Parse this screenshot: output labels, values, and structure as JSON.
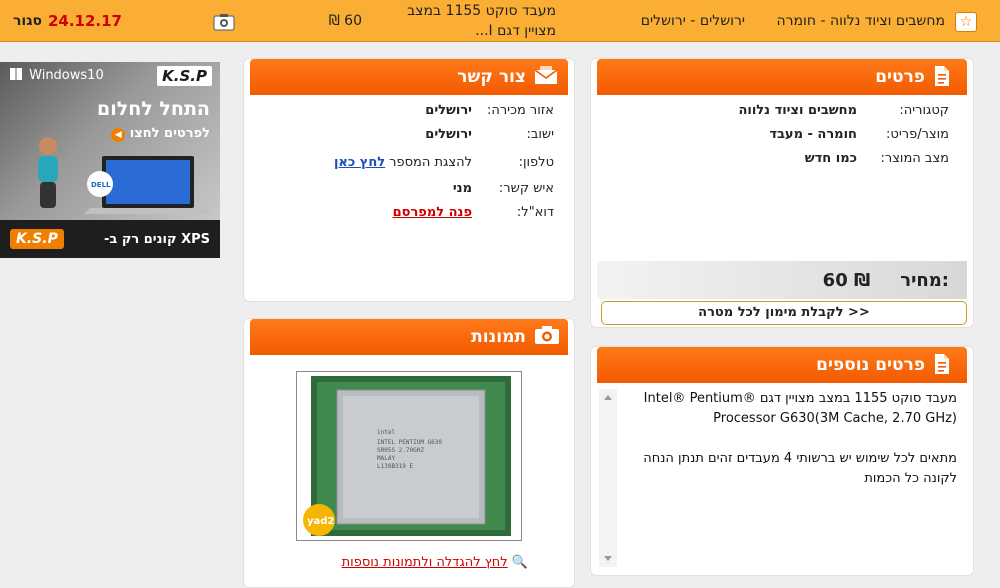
{
  "topbar": {
    "category": "מחשבים וציוד נלווה - חומרה",
    "location": "ירושלים - ירושלים",
    "title": "מעבד סוקט 1155 במצב מצויין דגם I...",
    "price": "60 ₪",
    "date": "24.12.17",
    "close": "סגור"
  },
  "details": {
    "header": "פרטים",
    "rows": [
      {
        "label": "קטגוריה:",
        "value": "מחשבים וציוד נלווה"
      },
      {
        "label": "מוצר/פריט:",
        "value": "חומרה - מעבד"
      },
      {
        "label": "מצב המוצר:",
        "value": "כמו חדש"
      }
    ],
    "price_label": "מחיר:",
    "price_value": "60 ₪",
    "finance_button": "לקבלת מימון לכל מטרה >>"
  },
  "more_details": {
    "header": "פרטים נוספים",
    "line1": "מעבד סוקט 1155 במצב מצויין דגם Intel® Pentium® Processor G630(3M Cache, 2.70 GHz)",
    "line2": "מתאים לכל שימוש יש ברשותי 4 מעבדים זהים תנתן הנחה לקונה כל הכמות"
  },
  "contact": {
    "header": "צור קשר",
    "area_label": "אזור מכירה:",
    "area_value": "ירושלים",
    "city_label": "ישוב:",
    "city_value": "ירושלים",
    "phone_label": "טלפון:",
    "phone_text": "להצגת המספר",
    "phone_link": "לחץ כאן",
    "person_label": "איש קשר:",
    "person_value": "מני",
    "email_label": "דוא\"ל:",
    "email_link": "פנה למפרסם"
  },
  "photos": {
    "header": "תמונות",
    "more_link": "לחץ להגדלה ולתמונות נוספות",
    "watermark": "yad2"
  },
  "ad": {
    "brand": "Windows10",
    "store": "K.S.P",
    "headline": "התחל לחלום",
    "sub": "לפרטים לחצו",
    "laptop_brand": "DELL",
    "bottom_text": "XPS קונים רק ב-",
    "bottom_store": "K.S.P"
  },
  "colors": {
    "accent": "#f25a00",
    "topbar": "#fbae34",
    "date": "#d00000"
  }
}
